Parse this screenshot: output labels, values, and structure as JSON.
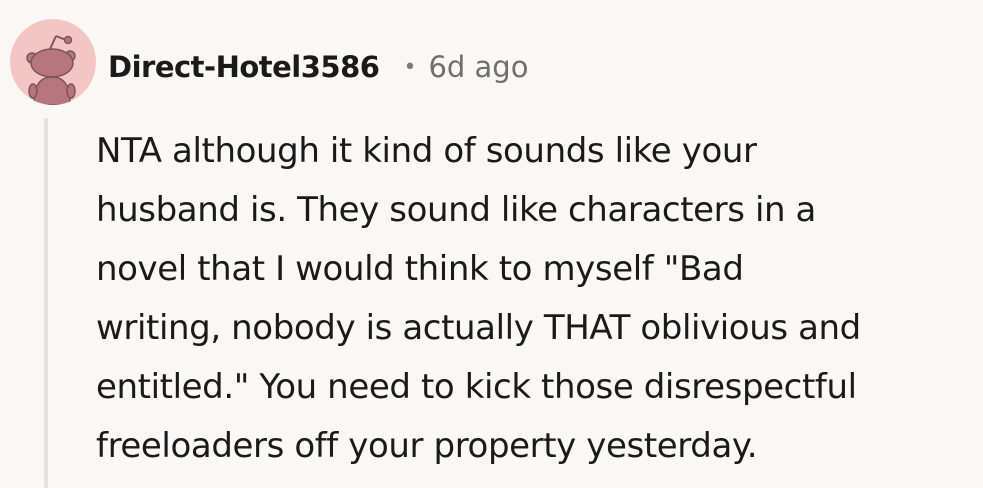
{
  "comment": {
    "username": "Direct-Hotel3586",
    "separator": "•",
    "timestamp": "6d ago",
    "avatar_icon": "snoo-avatar-icon",
    "body_lines": [
      "NTA although it kind of sounds like your",
      "husband is. They sound like characters in a",
      "novel that I would think to myself \"Bad",
      "writing, nobody is actually THAT oblivious and",
      "entitled.\" You need to kick those disrespectful",
      "freeloaders off your property yesterday."
    ]
  },
  "colors": {
    "background": "#faf8f6",
    "avatar_bg": "#f3c6c3",
    "avatar_figure": "#b5777c",
    "thread_line": "#e4e1de",
    "text": "#1a1a1b",
    "meta_text": "#6f6f6f"
  }
}
